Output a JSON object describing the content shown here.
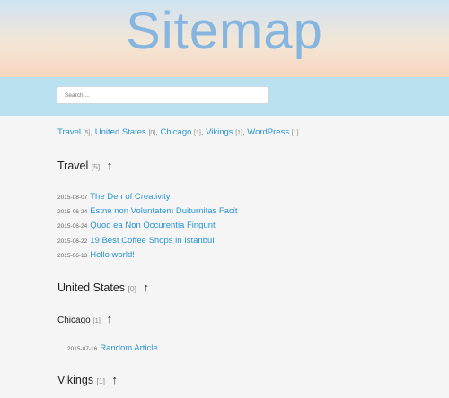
{
  "header": {
    "title": "Sitemap"
  },
  "search": {
    "placeholder": "Search ..."
  },
  "category_links": [
    {
      "label": "Travel",
      "count": "[5]"
    },
    {
      "label": "United States",
      "count": "[0]"
    },
    {
      "label": "Chicago",
      "count": "[1]"
    },
    {
      "label": "Vikings",
      "count": "[1]"
    },
    {
      "label": "WordPress",
      "count": "[1]"
    }
  ],
  "sections": {
    "travel": {
      "title": "Travel",
      "count": "[5]",
      "top_icon": "↑",
      "posts": [
        {
          "date": "2015-08-07",
          "title": "The Den of Creativity"
        },
        {
          "date": "2015-06-24",
          "title": "Estne non Voluntatem Duiturnitas Facit"
        },
        {
          "date": "2015-06-24",
          "title": "Quod ea Non Occurentia Fingunt"
        },
        {
          "date": "2015-06-22",
          "title": "19 Best Coffee Shops in Istanbul"
        },
        {
          "date": "2015-06-13",
          "title": "Hello world!"
        }
      ]
    },
    "united_states": {
      "title": "United States",
      "count": "[0]",
      "top_icon": "↑"
    },
    "chicago": {
      "title": "Chicago",
      "count": "[1]",
      "top_icon": "↑",
      "posts": [
        {
          "date": "2015-07-16",
          "title": "Random Article"
        }
      ]
    },
    "vikings": {
      "title": "Vikings",
      "count": "[1]",
      "top_icon": "↑"
    }
  }
}
